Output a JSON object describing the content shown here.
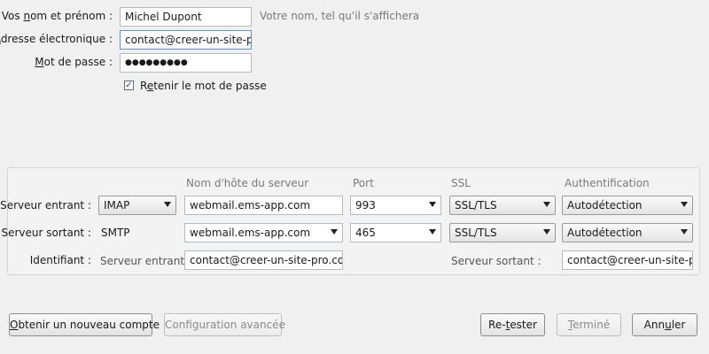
{
  "account": {
    "name_label_pre": "Vos ",
    "name_label_u": "n",
    "name_label_post": "om et prénom :",
    "name_value": "Michel Dupont",
    "name_hint": "Votre nom, tel qu'il s'affichera",
    "email_label_u": "A",
    "email_label_post": "dresse électronique :",
    "email_value": "contact@creer-un-site-pro",
    "password_label_u": "M",
    "password_label_post": "ot de passe :",
    "password_mask": "●●●●●●●●●",
    "remember_label_pre": "R",
    "remember_label_u": "e",
    "remember_label_post": "tenir le mot de passe",
    "remember_checked": true,
    "check_mark": "✓"
  },
  "server": {
    "headers": {
      "hostname": "Nom d'hôte du serveur",
      "port": "Port",
      "ssl": "SSL",
      "auth": "Authentification"
    },
    "incoming": {
      "label": "Serveur entrant :",
      "protocol": "IMAP",
      "hostname": "webmail.ems-app.com",
      "port": "993",
      "ssl": "SSL/TLS",
      "auth": "Autodétection"
    },
    "outgoing": {
      "label": "Serveur sortant :",
      "protocol": "SMTP",
      "hostname": "webmail.ems-app.com",
      "port": "465",
      "ssl": "SSL/TLS",
      "auth": "Autodétection"
    },
    "identifier": {
      "label": "Identifiant :",
      "incoming_label": "Serveur entrant :",
      "incoming_value": "contact@creer-un-site-pro.com",
      "outgoing_label": "Serveur sortant :",
      "outgoing_value": "contact@creer-un-site-pro.com"
    }
  },
  "buttons": {
    "new_account_u": "O",
    "new_account_post": "btenir un nouveau compte",
    "advanced": "Configuration avancée",
    "retest_pre": "Re-",
    "retest_u": "t",
    "retest_post": "ester",
    "done_u": "T",
    "done_post": "erminé",
    "cancel_pre": "Ann",
    "cancel_u": "u",
    "cancel_post": "ler"
  }
}
